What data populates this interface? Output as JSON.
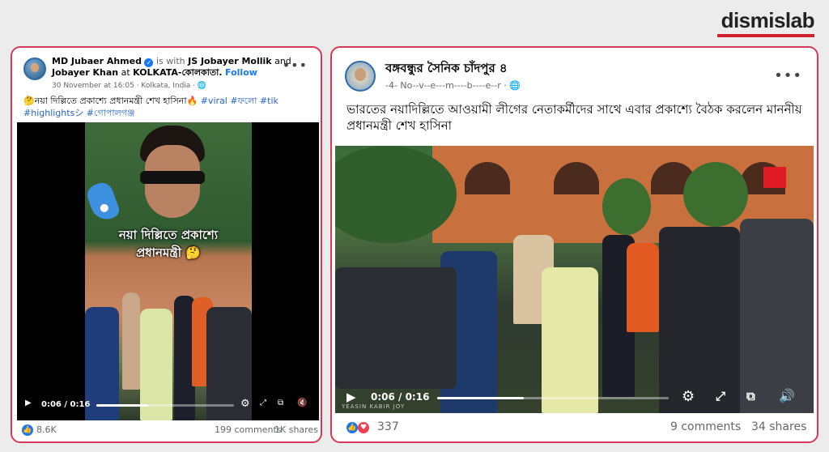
{
  "brand": {
    "name": "dismislab",
    "accent": "#d0212f"
  },
  "left_post": {
    "author": "MD Jubaer Ahmed",
    "is_with_prefix": "is with",
    "with_1": "JS Jobayer Mollik",
    "and": "and",
    "with_2": "Jobayer Khan",
    "at": "at",
    "location": "KOLKATA-কোলকাতা.",
    "follow": "Follow",
    "meta": "30 November at 16:05 · Kolkata, India ·",
    "text": "🤔নয়া দিল্লিতে প্রকাশ্যে প্রধানমন্ত্রী শেখ হাসিনা🔥",
    "hashtags_line1": "#viral #ফলো #tik",
    "hashtags_line2": "#highlightsシ #গোপালগঞ্জ",
    "video_overlay_1": "নয়া দিল্লিতে প্রকাশ্যে",
    "video_overlay_2": "প্রধানমন্ত্রী 🤔",
    "time": "0:06 / 0:16",
    "progress": 0.375,
    "reactions": "8.6K",
    "comments": "199 comments",
    "shares": "1K shares",
    "icons": [
      "verified-icon",
      "globe-icon",
      "more-icon",
      "play-icon",
      "settings-icon",
      "fullscreen-icon",
      "pip-icon",
      "mute-icon",
      "like-icon"
    ]
  },
  "right_post": {
    "page_name": "বঙ্গবন্ধুর সৈনিক চাঁদপুর ৪",
    "meta": "-4- No--v--e---m----b----e--r ·",
    "text": "ভারতের নয়াদিল্লিতে আওয়ামী লীগের নেতাকর্মীদের সাথে এবার প্রকাশ্যে বৈঠক করলেন মাননীয় প্রধানমন্ত্রী শেখ হাসিনা",
    "time": "0:06 / 0:16",
    "progress": 0.375,
    "watermark": "YEASIN KABIR JOY",
    "reactions": "337",
    "comments": "9 comments",
    "shares": "34 shares",
    "icons": [
      "globe-icon",
      "more-icon",
      "play-icon",
      "settings-icon",
      "fullscreen-icon",
      "pip-icon",
      "volume-icon",
      "like-icon",
      "love-icon"
    ]
  },
  "colors": {
    "card_border": "#d43a55",
    "link": "#1877f2",
    "hashtag": "#2466c9"
  }
}
